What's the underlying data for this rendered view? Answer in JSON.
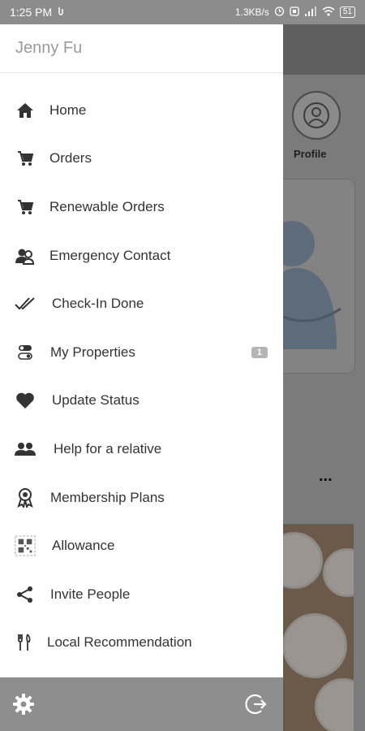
{
  "status_bar": {
    "time": "1:25 PM",
    "network_speed": "1.3KB/s",
    "battery": "51"
  },
  "drawer": {
    "user_name": "Jenny Fu",
    "items": [
      {
        "label": "Home",
        "icon": "home-icon"
      },
      {
        "label": "Orders",
        "icon": "cart-icon"
      },
      {
        "label": "Renewable Orders",
        "icon": "cart-icon"
      },
      {
        "label": "Emergency Contact",
        "icon": "contacts-icon"
      },
      {
        "label": "Check-In Done",
        "icon": "double-check-icon"
      },
      {
        "label": "My Properties",
        "icon": "toggles-icon",
        "badge": "1"
      },
      {
        "label": "Update Status",
        "icon": "heart-icon"
      },
      {
        "label": "Help for a relative",
        "icon": "people-icon"
      },
      {
        "label": "Membership Plans",
        "icon": "award-icon"
      },
      {
        "label": "Allowance",
        "icon": "qr-icon"
      },
      {
        "label": "Invite People",
        "icon": "share-icon"
      },
      {
        "label": "Local Recommendation",
        "icon": "utensils-icon"
      }
    ],
    "footer": {
      "settings_icon": "gear-icon",
      "logout_icon": "logout-icon"
    }
  },
  "background": {
    "profile_label": "Profile",
    "more_label": "..."
  }
}
